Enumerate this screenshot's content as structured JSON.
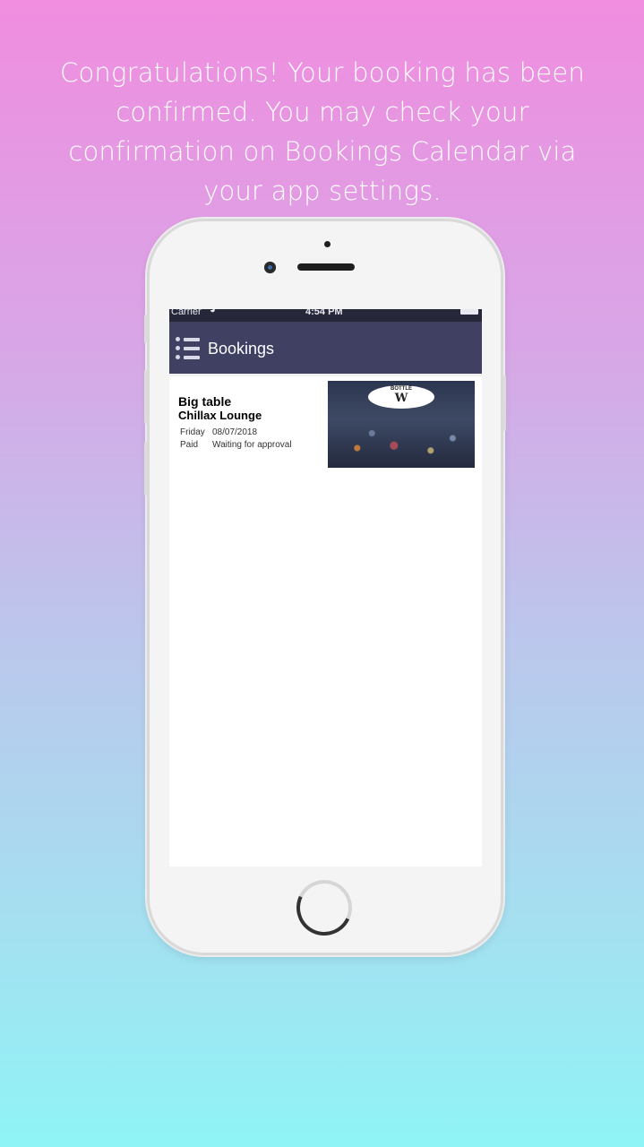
{
  "headline": "Congratulations! Your booking has been confirmed. You may check your confirmation on Bookings Calendar via your app settings.",
  "status_bar": {
    "carrier": "Carrier",
    "time": "4:54 PM",
    "wifi_icon": "wifi-icon",
    "battery_icon": "battery-icon"
  },
  "nav": {
    "menu_icon": "list-menu-icon",
    "title": "Bookings"
  },
  "bookings": [
    {
      "title": "Big table",
      "venue": "Chillax Lounge",
      "day": "Friday",
      "date": "08/07/2018",
      "payment": "Paid",
      "status": "Waiting for approval",
      "logo_text": "BOTTLE",
      "logo_letter": "W"
    }
  ],
  "colors": {
    "nav_bar": "#3f4062",
    "status_bar": "#26283a",
    "gradient_top": "#f08ddf",
    "gradient_bottom": "#8ff4f6"
  }
}
